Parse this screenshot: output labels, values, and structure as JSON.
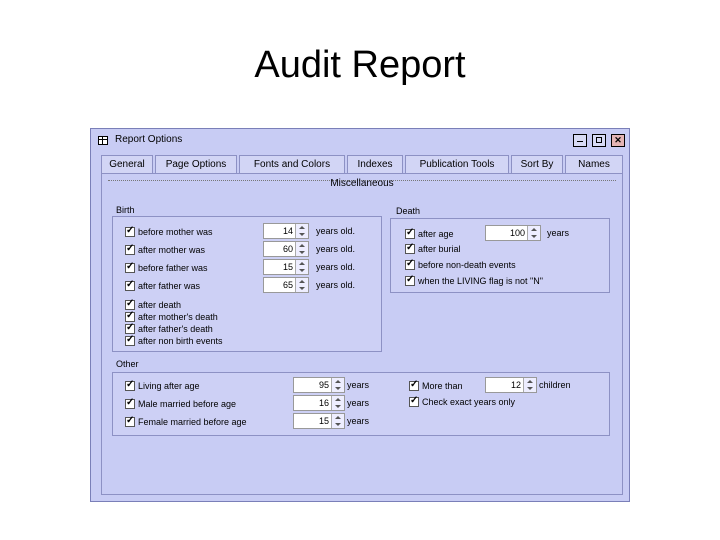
{
  "slide": {
    "title": "Audit Report"
  },
  "window": {
    "title": "Report Options"
  },
  "tabs": [
    "General",
    "Page Options",
    "Fonts and Colors",
    "Indexes",
    "Publication Tools",
    "Sort By",
    "Names"
  ],
  "panel": {
    "title": "Miscellaneous"
  },
  "birth": {
    "label": "Birth",
    "spin_rows": [
      {
        "label": "before mother was",
        "value": "14",
        "unit": "years old."
      },
      {
        "label": "after mother was",
        "value": "60",
        "unit": "years old."
      },
      {
        "label": "before father was",
        "value": "15",
        "unit": "years old."
      },
      {
        "label": "after father was",
        "value": "65",
        "unit": "years old."
      }
    ],
    "checks": [
      "after death",
      "after mother's death",
      "after father's death",
      "after non birth events"
    ]
  },
  "death": {
    "label": "Death",
    "after_age": {
      "label": "after age",
      "value": "100",
      "unit": "years"
    },
    "checks": [
      "after burial",
      "before non-death events",
      "when the LIVING flag is not \"N\""
    ]
  },
  "other": {
    "label": "Other",
    "rows": [
      {
        "label": "Living after age",
        "value": "95",
        "unit": "years"
      },
      {
        "label": "Male married before age",
        "value": "16",
        "unit": "years"
      },
      {
        "label": "Female married before age",
        "value": "15",
        "unit": "years"
      }
    ],
    "more_than": {
      "label": "More than",
      "value": "12",
      "unit": "children"
    },
    "check_exact": "Check exact years only"
  }
}
